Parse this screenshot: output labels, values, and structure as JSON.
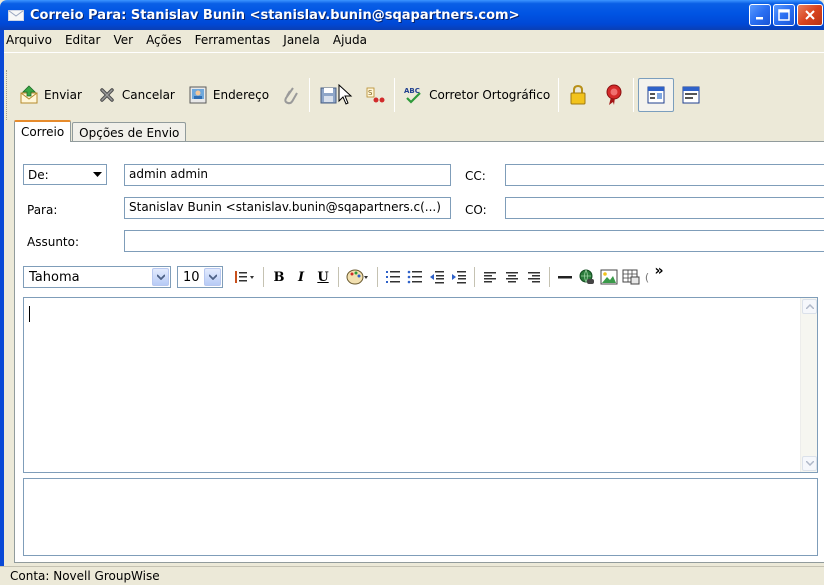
{
  "window": {
    "title": "Correio Para: Stanislav Bunin <stanislav.bunin@sqapartners.com>"
  },
  "menu": [
    "Arquivo",
    "Editar",
    "Ver",
    "Ações",
    "Ferramentas",
    "Janela",
    "Ajuda"
  ],
  "toolbar": {
    "send_label": "Enviar",
    "cancel_label": "Cancelar",
    "address_label": "Endereço",
    "spell_label": "Corretor Ortográfico"
  },
  "tabs": [
    "Correio",
    "Opções de Envio"
  ],
  "form": {
    "from_select": "De:",
    "from_value": "admin admin",
    "to_label": "Para:",
    "to_value": "Stanislav Bunin <stanislav.bunin@sqapartners.c(...)",
    "cc_label": "CC:",
    "cc_value": "",
    "bcc_label": "CO:",
    "bcc_value": "",
    "subject_label": "Assunto:",
    "subject_value": ""
  },
  "format": {
    "font_name": "Tahoma",
    "font_size": "10",
    "bold": "B",
    "italic": "I",
    "underline": "U",
    "overflow": "»"
  },
  "status": {
    "text": "Conta: Novell GroupWise"
  },
  "colors": {
    "titlebar": "#0054e3",
    "active_tab_accent": "#e68b2c",
    "input_border": "#7f9db9"
  }
}
